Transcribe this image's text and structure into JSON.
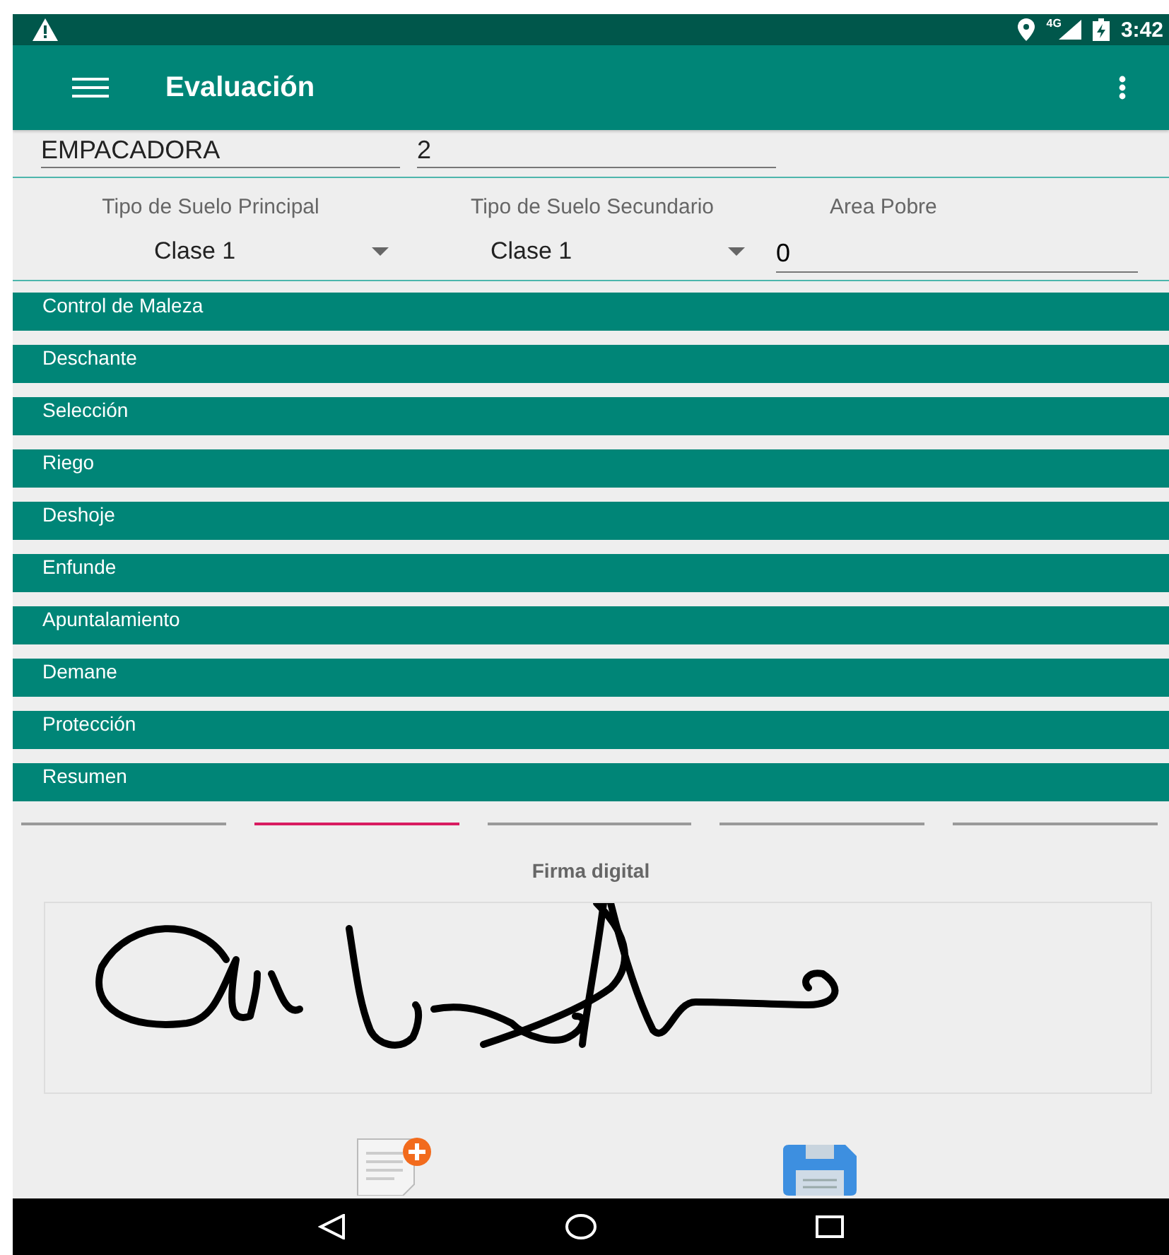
{
  "status_bar": {
    "time": "3:42",
    "network": "4G"
  },
  "toolbar": {
    "title": "Evaluación"
  },
  "top_fields": [
    {
      "value": "EMPACADORA"
    },
    {
      "value": "2"
    }
  ],
  "soil": {
    "primary": {
      "label": "Tipo de Suelo Principal",
      "value": "Clase 1"
    },
    "secondary": {
      "label": "Tipo de Suelo Secundario",
      "value": "Clase 1"
    },
    "poor_area": {
      "label": "Area Pobre",
      "value": "0"
    }
  },
  "sections": [
    {
      "label": "Control de Maleza"
    },
    {
      "label": "Deschante"
    },
    {
      "label": "Selección"
    },
    {
      "label": "Riego"
    },
    {
      "label": "Deshoje"
    },
    {
      "label": "Enfunde"
    },
    {
      "label": "Apuntalamiento"
    },
    {
      "label": "Demane"
    },
    {
      "label": "Protección"
    },
    {
      "label": "Resumen"
    }
  ],
  "pager": [
    {
      "selected": false
    },
    {
      "selected": true
    },
    {
      "selected": false
    },
    {
      "selected": false
    },
    {
      "selected": false
    }
  ],
  "signature": {
    "title": "Firma digital"
  }
}
